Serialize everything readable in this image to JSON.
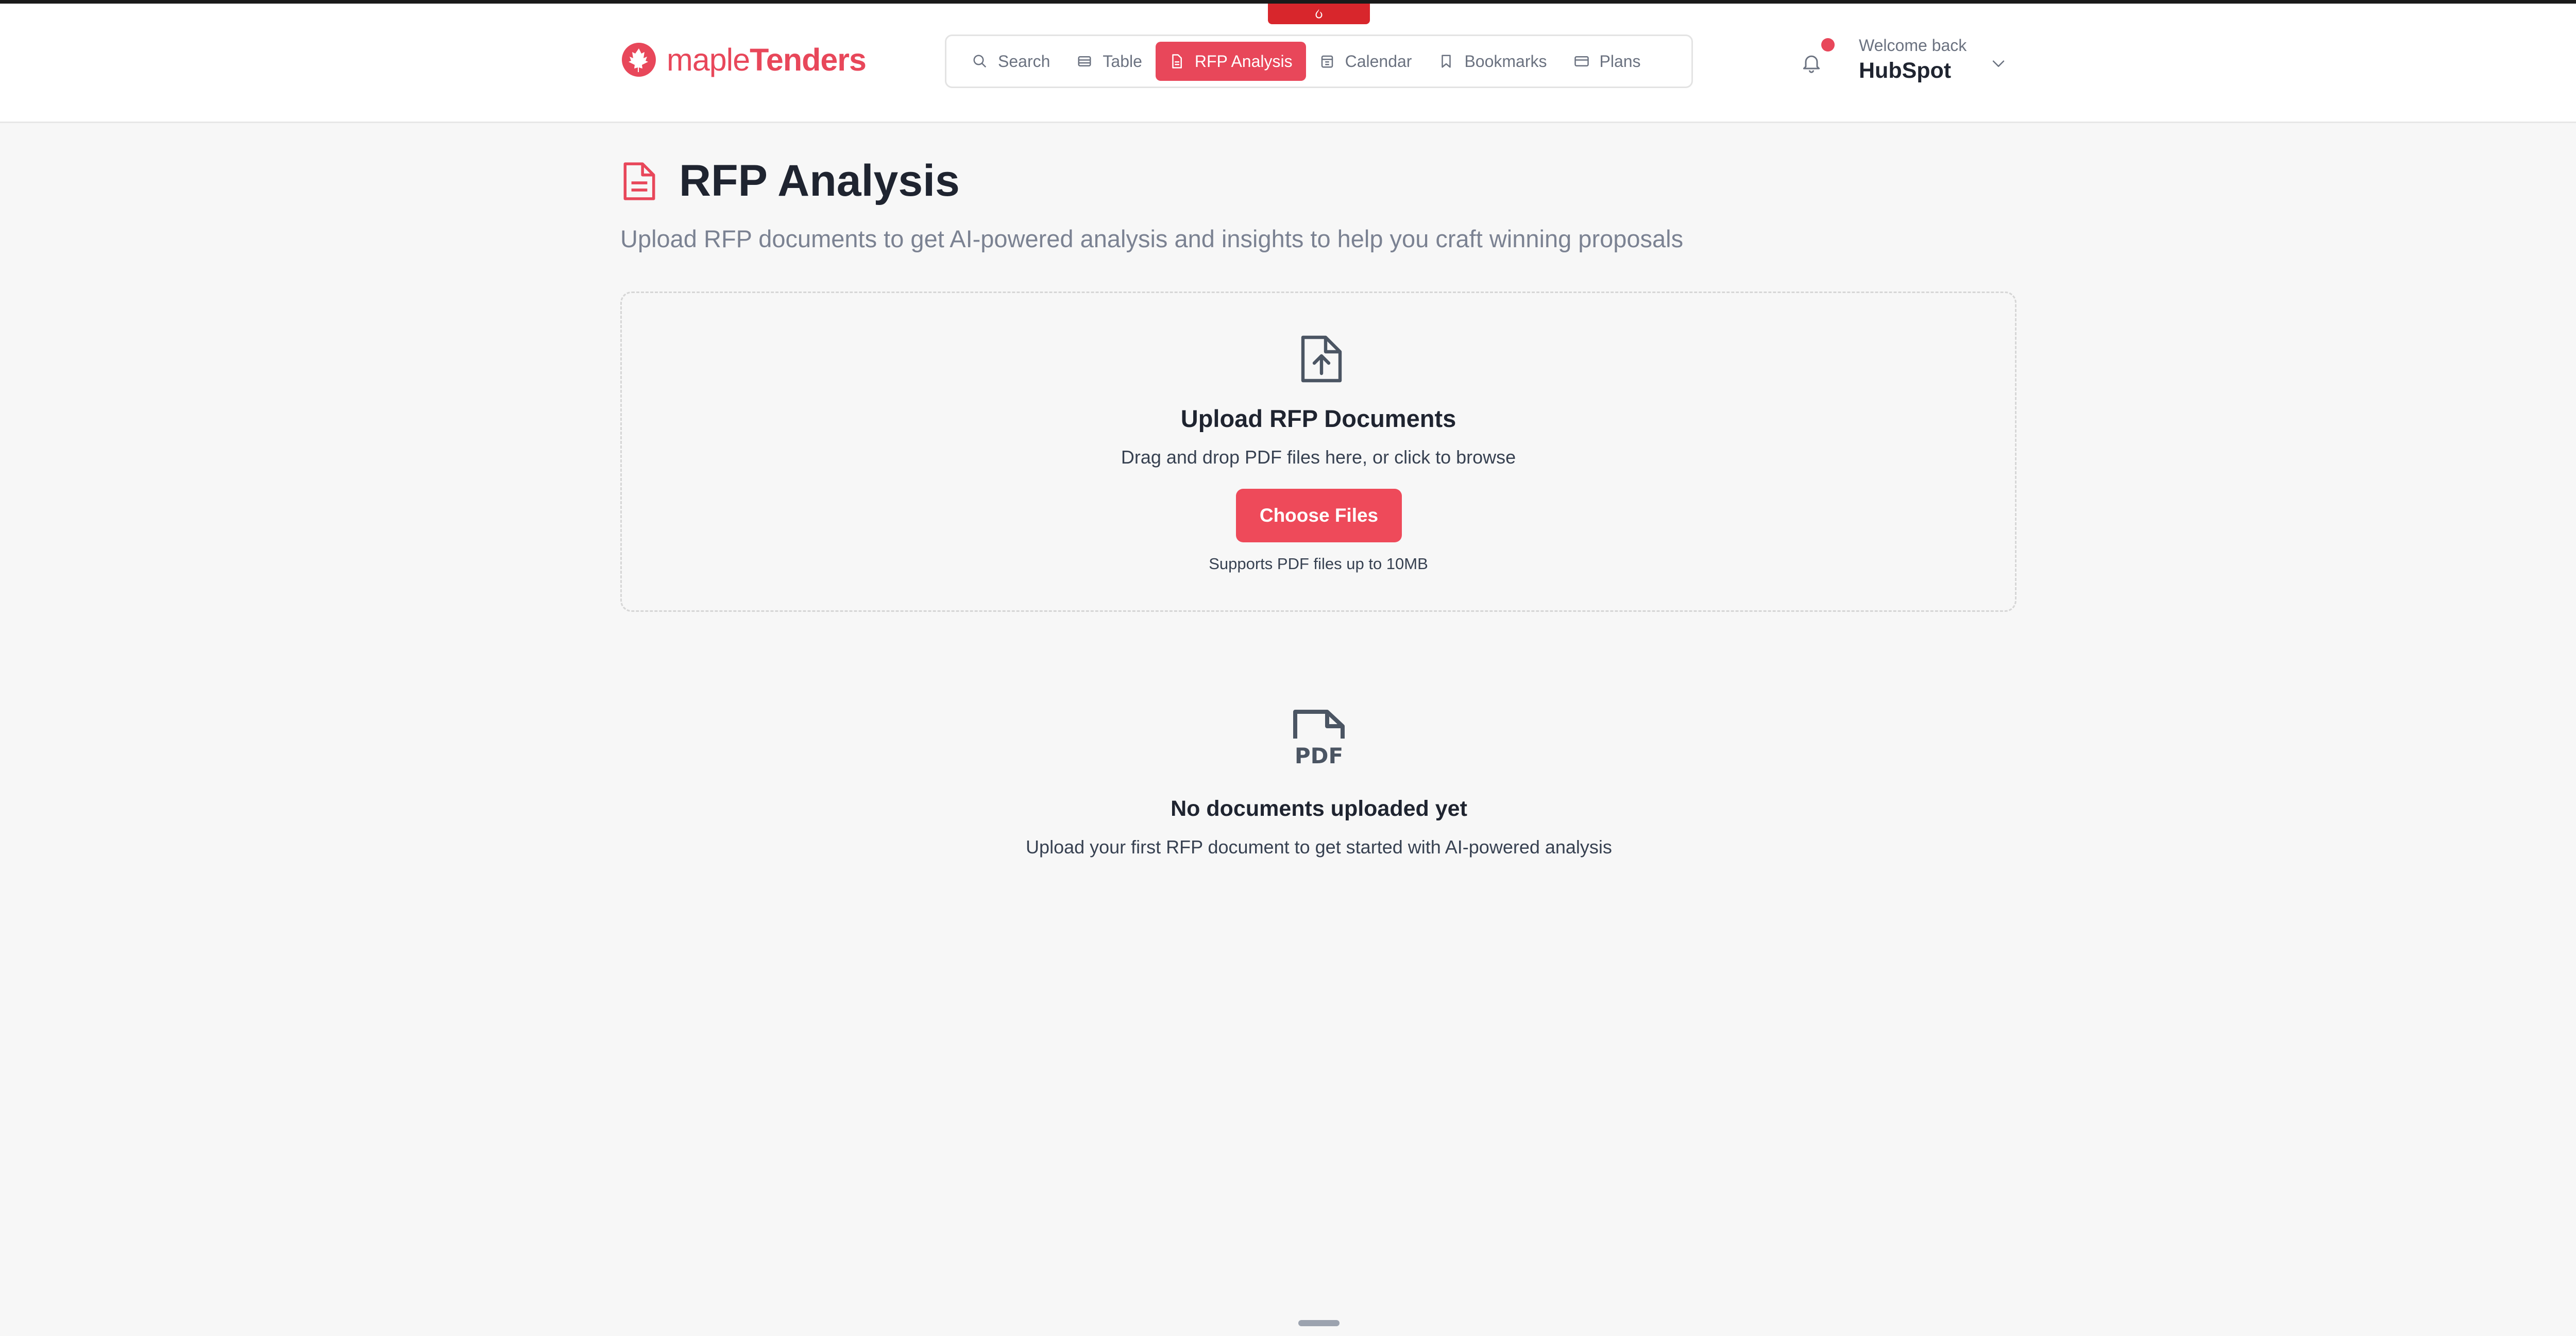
{
  "brand": {
    "prefix": "maple",
    "suffix": "Tenders",
    "color": "#e8475a"
  },
  "nav": {
    "items": [
      {
        "label": "Search",
        "icon": "search-icon",
        "active": false
      },
      {
        "label": "Table",
        "icon": "table-icon",
        "active": false
      },
      {
        "label": "RFP Analysis",
        "icon": "document-icon",
        "active": true
      },
      {
        "label": "Calendar",
        "icon": "calendar-icon",
        "active": false
      },
      {
        "label": "Bookmarks",
        "icon": "bookmark-icon",
        "active": false
      },
      {
        "label": "Plans",
        "icon": "credit-card-icon",
        "active": false
      }
    ]
  },
  "user": {
    "welcome_label": "Welcome back",
    "name": "HubSpot"
  },
  "page": {
    "title": "RFP Analysis",
    "subtitle": "Upload RFP documents to get AI-powered analysis and insights to help you craft winning proposals"
  },
  "upload": {
    "title": "Upload RFP Documents",
    "subtitle": "Drag and drop PDF files here, or click to browse",
    "button_label": "Choose Files",
    "note": "Supports PDF files up to 10MB"
  },
  "empty_state": {
    "icon_text": "PDF",
    "title": "No documents uploaded yet",
    "subtitle": "Upload your first RFP document to get started with AI-powered analysis"
  },
  "colors": {
    "accent": "#e8475a",
    "button": "#ee4a5a",
    "top_tab": "#d8262c",
    "background": "#f7f7f7"
  }
}
